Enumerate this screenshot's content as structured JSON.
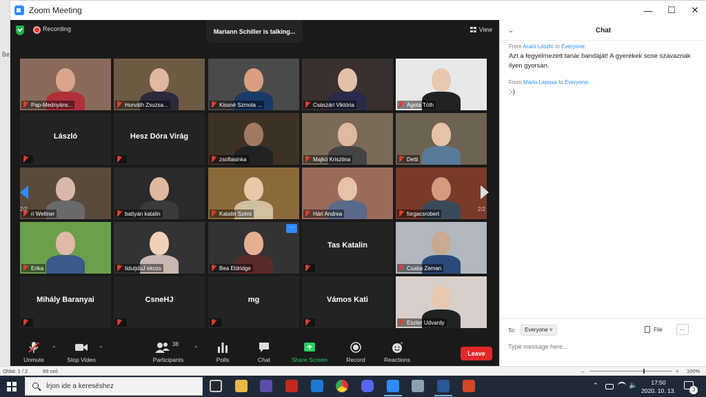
{
  "window": {
    "title": "Zoom Meeting"
  },
  "background_word": {
    "left_hint": "Be"
  },
  "meeting": {
    "recording_label": "Recording",
    "talking_label": "Mariann Schiller is talking...",
    "view_label": "View",
    "page_left": "2/2",
    "page_right": "2/2"
  },
  "tiles": [
    {
      "name": "Pap-Mednyáns...",
      "video": true
    },
    {
      "name": "Horváth Zsuzsa...",
      "video": true
    },
    {
      "name": "Kissné Szmola ...",
      "video": true
    },
    {
      "name": "Császári Viktória",
      "video": true
    },
    {
      "name": "Ágota Tóth",
      "video": true
    },
    {
      "name": "László",
      "video": false
    },
    {
      "name": "Hesz Dóra Virág",
      "video": false
    },
    {
      "name": "zsofiasinka",
      "video": true
    },
    {
      "name": "Majkó Krisztina",
      "video": true
    },
    {
      "name": "Detti",
      "video": true
    },
    {
      "name": "ri Weltner",
      "video": true
    },
    {
      "name": "battyán katalin",
      "video": true
    },
    {
      "name": "Katalin Széni",
      "video": true
    },
    {
      "name": "Hári Andrea",
      "video": true
    },
    {
      "name": "forgacsrobert",
      "video": true
    },
    {
      "name": "Erika",
      "video": true
    },
    {
      "name": "tidutjduJ ekozs",
      "video": true
    },
    {
      "name": "Bea Eldridge",
      "video": true
    },
    {
      "name": "Tas Katalin",
      "video": false
    },
    {
      "name": "Csaba Zeman",
      "video": true
    },
    {
      "name": "Mihály Baranyai",
      "video": false
    },
    {
      "name": "CsneHJ",
      "video": false
    },
    {
      "name": "mg",
      "video": false
    },
    {
      "name": "Vámos Kati",
      "video": false
    },
    {
      "name": "Eszter Udvardy",
      "video": true
    }
  ],
  "toolbar": {
    "unmute": "Unmute",
    "stop_video": "Stop Video",
    "participants": "Participants",
    "participants_count": "38",
    "polls": "Polls",
    "chat": "Chat",
    "share_screen": "Share Screen",
    "record": "Record",
    "reactions": "Reactions",
    "leave": "Leave"
  },
  "chat": {
    "title": "Chat",
    "messages": [
      {
        "from_prefix": "From",
        "sender": "Arató László",
        "to_word": "to",
        "recipient": "Everyone:",
        "text": "Azt a fegyelmezett tanár bandáját! A gyerekek sose szavaznak ilyen gyorsan."
      },
      {
        "from_prefix": "From",
        "sender": "Márta Leposa",
        "to_word": "to",
        "recipient": "Everyone:",
        "text": ":-)"
      }
    ],
    "to_label": "To:",
    "to_value": "Everyone",
    "file_label": "File",
    "more_label": "...",
    "input_placeholder": "Type message here..."
  },
  "statusbar": {
    "page": "Oldal: 1 / 2",
    "words": "89 szó",
    "zoom": "100%",
    "minus": "–",
    "plus": "+"
  },
  "taskbar": {
    "search_placeholder": "Írjon ide a kereséshez",
    "time": "17:50",
    "date": "2020. 10. 13.",
    "notifications": "3"
  }
}
